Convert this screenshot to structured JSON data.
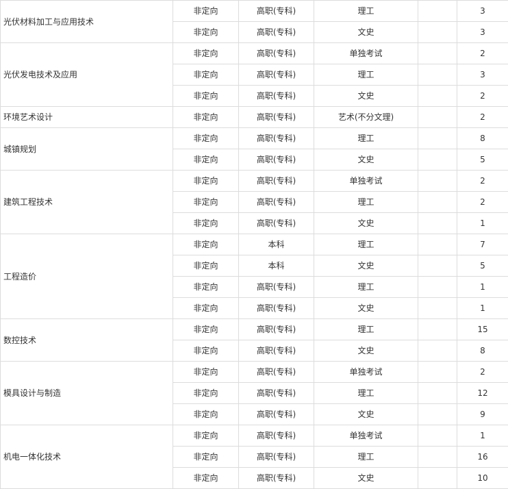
{
  "table": {
    "groups": [
      {
        "major": "光伏材料加工与应用技术",
        "rows": [
          {
            "type": "非定向",
            "level": "高职(专科)",
            "category": "理工",
            "count": "3"
          },
          {
            "type": "非定向",
            "level": "高职(专科)",
            "category": "文史",
            "count": "3"
          }
        ]
      },
      {
        "major": "光伏发电技术及应用",
        "rows": [
          {
            "type": "非定向",
            "level": "高职(专科)",
            "category": "单独考试",
            "count": "2"
          },
          {
            "type": "非定向",
            "level": "高职(专科)",
            "category": "理工",
            "count": "3"
          },
          {
            "type": "非定向",
            "level": "高职(专科)",
            "category": "文史",
            "count": "2"
          }
        ]
      },
      {
        "major": "环境艺术设计",
        "rows": [
          {
            "type": "非定向",
            "level": "高职(专科)",
            "category": "艺术(不分文理)",
            "count": "2"
          }
        ]
      },
      {
        "major": "城镇规划",
        "rows": [
          {
            "type": "非定向",
            "level": "高职(专科)",
            "category": "理工",
            "count": "8"
          },
          {
            "type": "非定向",
            "level": "高职(专科)",
            "category": "文史",
            "count": "5"
          }
        ]
      },
      {
        "major": "建筑工程技术",
        "rows": [
          {
            "type": "非定向",
            "level": "高职(专科)",
            "category": "单独考试",
            "count": "2"
          },
          {
            "type": "非定向",
            "level": "高职(专科)",
            "category": "理工",
            "count": "2"
          },
          {
            "type": "非定向",
            "level": "高职(专科)",
            "category": "文史",
            "count": "1"
          }
        ]
      },
      {
        "major": "工程造价",
        "rows": [
          {
            "type": "非定向",
            "level": "本科",
            "category": "理工",
            "count": "7"
          },
          {
            "type": "非定向",
            "level": "本科",
            "category": "文史",
            "count": "5"
          },
          {
            "type": "非定向",
            "level": "高职(专科)",
            "category": "理工",
            "count": "1"
          },
          {
            "type": "非定向",
            "level": "高职(专科)",
            "category": "文史",
            "count": "1"
          }
        ]
      },
      {
        "major": "数控技术",
        "rows": [
          {
            "type": "非定向",
            "level": "高职(专科)",
            "category": "理工",
            "count": "15"
          },
          {
            "type": "非定向",
            "level": "高职(专科)",
            "category": "文史",
            "count": "8"
          }
        ]
      },
      {
        "major": "模具设计与制造",
        "rows": [
          {
            "type": "非定向",
            "level": "高职(专科)",
            "category": "单独考试",
            "count": "2"
          },
          {
            "type": "非定向",
            "level": "高职(专科)",
            "category": "理工",
            "count": "12"
          },
          {
            "type": "非定向",
            "level": "高职(专科)",
            "category": "文史",
            "count": "9"
          }
        ]
      },
      {
        "major": "机电一体化技术",
        "rows": [
          {
            "type": "非定向",
            "level": "高职(专科)",
            "category": "单独考试",
            "count": "1"
          },
          {
            "type": "非定向",
            "level": "高职(专科)",
            "category": "理工",
            "count": "16"
          },
          {
            "type": "非定向",
            "level": "高职(专科)",
            "category": "文史",
            "count": "10"
          }
        ]
      }
    ]
  }
}
